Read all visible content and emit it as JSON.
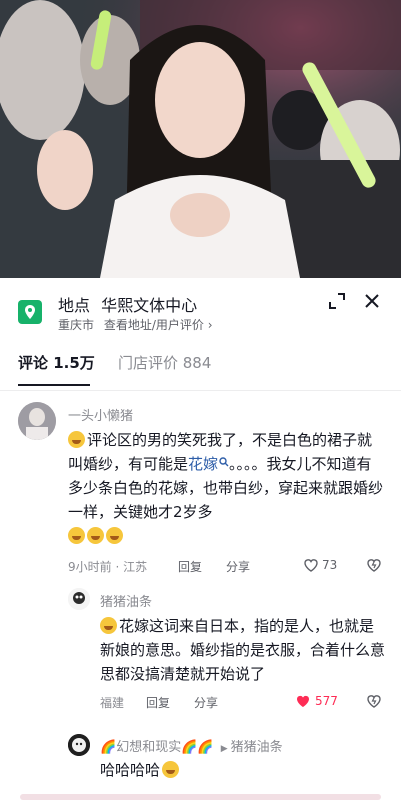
{
  "location": {
    "prefix": "地点",
    "venue": "华熙文体中心",
    "city": "重庆市",
    "link": "查看地址/用户评价 ›",
    "pin_icon": "location-pin-icon",
    "accent": "#17b26a"
  },
  "tabs": [
    {
      "label": "评论 1.5万",
      "active": true
    },
    {
      "label": "门店评价 884",
      "active": false
    }
  ],
  "comments": [
    {
      "user": "一头小懒猪",
      "text_a": "评论区的男的笑死我了，不是白色的裙子就叫婚纱，有可能是",
      "keyword": "花嫁",
      "text_b": "。。。。我女儿不知道有多少条白色的花嫁，也带白纱，穿起来就跟婚纱一样，关键她才2岁多",
      "time_loc": "9小时前 · 江苏",
      "reply": "回复",
      "share": "分享",
      "likes": "73"
    }
  ],
  "replies": [
    {
      "user": "猪猪油条",
      "text": "花嫁这词来自日本，指的是人，也就是新娘的意思。婚纱指的是衣服，合着什么意思都没搞清楚就开始说了",
      "location": "福建",
      "reply": "回复",
      "share": "分享",
      "likes": "577",
      "liked_color": "#fe2c55"
    },
    {
      "user": "幻想和现实",
      "reply_to": "猪猪油条",
      "text": "哈哈哈哈"
    }
  ]
}
